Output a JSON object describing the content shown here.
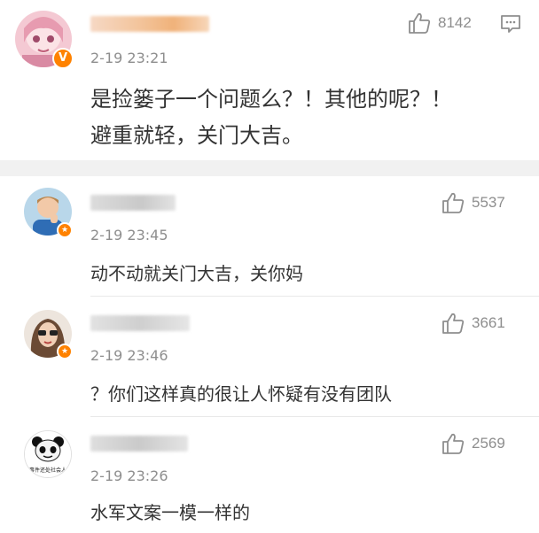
{
  "main_comment": {
    "username_hidden": true,
    "time": "2-19 23:21",
    "likes": "8142",
    "text_line1": "是捡篓子一个问题么？！其他的呢？！",
    "text_line2": "避重就轻，关门大吉。",
    "avatar_icon": "anime-girl-avatar",
    "badge_icon": "verified-v-badge",
    "like_icon": "thumbs-up-icon",
    "reply_icon": "message-icon"
  },
  "replies": [
    {
      "time": "2-19 23:45",
      "likes": "5537",
      "text": "动不动就关门大吉，关你妈",
      "avatar_icon": "boy-avatar"
    },
    {
      "time": "2-19 23:46",
      "likes": "3661",
      "text": "？你们这样真的很让人怀疑有没有团队",
      "avatar_icon": "woman-sunglasses-avatar"
    },
    {
      "time": "2-19 23:26",
      "likes": "2569",
      "text": "水军文案一模一样的",
      "avatar_icon": "panda-meme-avatar",
      "avatar_caption": "事件还处社会人"
    }
  ],
  "colors": {
    "accent_badge": "#ff8200",
    "meta_gray": "#8e8e8e",
    "text": "#333333",
    "band": "#f1f1f1"
  }
}
